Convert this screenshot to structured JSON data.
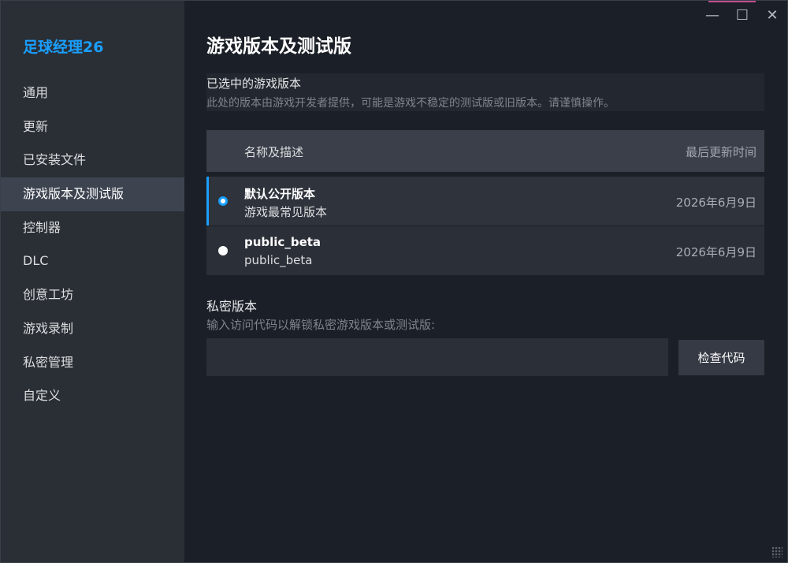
{
  "app": {
    "title": "足球经理26"
  },
  "window_controls": {
    "minimize": "—",
    "maximize": "☐",
    "close": "✕"
  },
  "sidebar": {
    "items": [
      {
        "label": "通用"
      },
      {
        "label": "更新"
      },
      {
        "label": "已安装文件"
      },
      {
        "label": "游戏版本及测试版",
        "active": true
      },
      {
        "label": "控制器"
      },
      {
        "label": "DLC"
      },
      {
        "label": "创意工坊"
      },
      {
        "label": "游戏录制"
      },
      {
        "label": "私密管理"
      },
      {
        "label": "自定义"
      }
    ]
  },
  "main": {
    "title": "游戏版本及测试版",
    "selected_section": {
      "title": "已选中的游戏版本",
      "description": "此处的版本由游戏开发者提供，可能是游戏不稳定的测试版或旧版本。请谨慎操作。"
    },
    "table": {
      "headers": {
        "name": "名称及描述",
        "date": "最后更新时间"
      },
      "rows": [
        {
          "name": "默认公开版本",
          "description": "游戏最常见版本",
          "date": "2026年6月9日",
          "selected": true
        },
        {
          "name": "public_beta",
          "description": "public_beta",
          "date": "2026年6月9日",
          "selected": false
        }
      ]
    },
    "private": {
      "title": "私密版本",
      "description": "输入访问代码以解锁私密游戏版本或测试版:",
      "input_value": "",
      "input_placeholder": "",
      "button_label": "检查代码"
    }
  },
  "colors": {
    "accent": "#1a9fff",
    "sidebar_bg": "#2a2e35",
    "main_bg": "#1b1f27",
    "active_item_bg": "#3d4450"
  }
}
